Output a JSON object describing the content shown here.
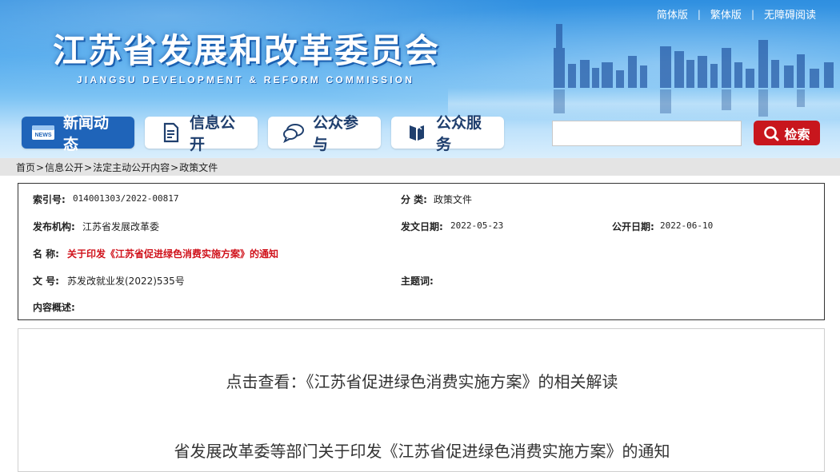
{
  "header": {
    "title": "江苏省发展和改革委员会",
    "subtitle": "JIANGSU DEVELOPMENT & REFORM COMMISSION",
    "top_links": [
      "简体版",
      "繁体版",
      "无障碍阅读"
    ],
    "separator": "|"
  },
  "nav": {
    "items": [
      {
        "label": "新闻动态",
        "icon": "news-icon",
        "badge": "NEWS"
      },
      {
        "label": "信息公开",
        "icon": "document-icon"
      },
      {
        "label": "公众参与",
        "icon": "chat-bubble-icon"
      },
      {
        "label": "公众服务",
        "icon": "service-book-icon"
      }
    ]
  },
  "search": {
    "placeholder": "",
    "button_label": "检索"
  },
  "breadcrumb": [
    "首页",
    "信息公开",
    "法定主动公开内容",
    "政策文件"
  ],
  "meta": {
    "index_no": {
      "label": "索引号:",
      "value": "014001303/2022-00817"
    },
    "category": {
      "label": "分 类:",
      "value": "政策文件"
    },
    "publisher": {
      "label": "发布机构:",
      "value": "江苏省发展改革委"
    },
    "issue_date": {
      "label": "发文日期:",
      "value": "2022-05-23"
    },
    "public_date": {
      "label": "公开日期:",
      "value": "2022-06-10"
    },
    "name": {
      "label": "名 称:",
      "value": "关于印发《江苏省促进绿色消费实施方案》的通知"
    },
    "doc_no": {
      "label": "文 号:",
      "value": "苏发改就业发(2022)535号"
    },
    "subject": {
      "label": "主题词:",
      "value": ""
    },
    "summary": {
      "label": "内容概述:",
      "value": ""
    }
  },
  "content": {
    "read_prefix": "点击查看：",
    "read_link": "《江苏省促进绿色消费实施方案》的相关解读",
    "doc_title": "省发展改革委等部门关于印发《江苏省促进绿色消费实施方案》的通知"
  },
  "colors": {
    "nav_active": "#1f64b9",
    "search_button": "#c8161d",
    "highlight_red": "#d0121b"
  }
}
